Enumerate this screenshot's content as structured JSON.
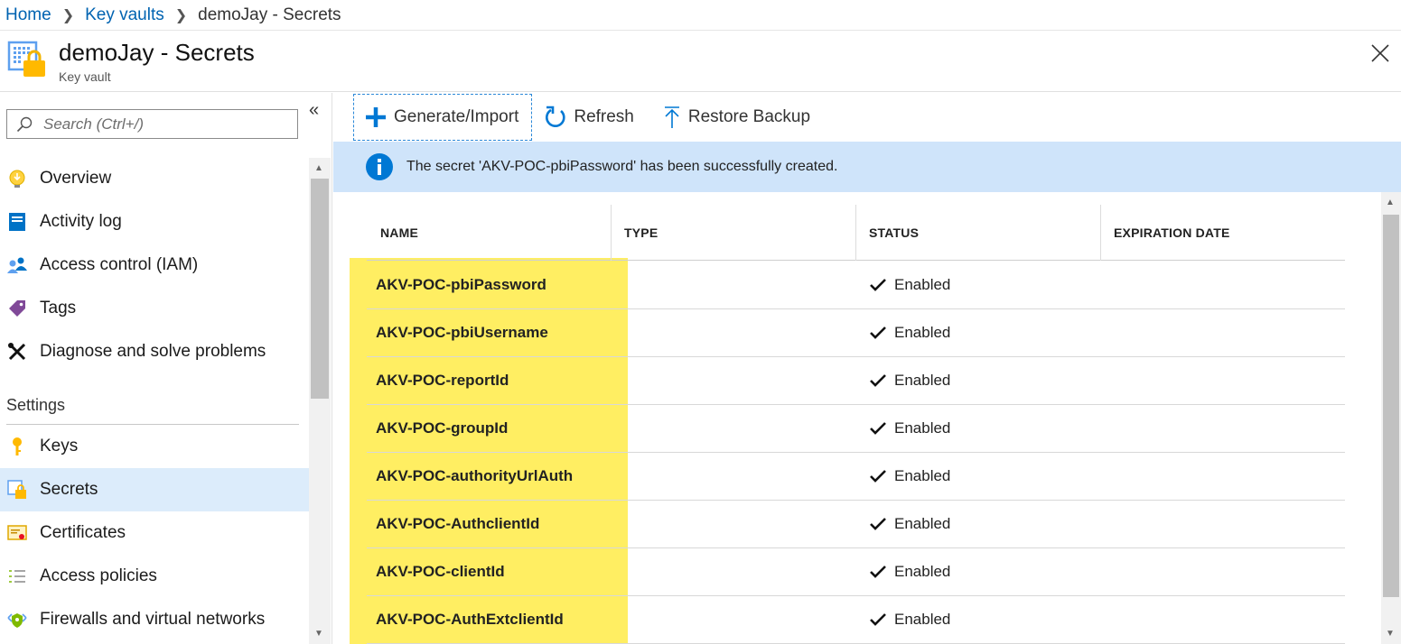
{
  "breadcrumb": {
    "home": "Home",
    "keyvaults": "Key vaults",
    "current": "demoJay - Secrets"
  },
  "header": {
    "title": "demoJay - Secrets",
    "subtitle": "Key vault"
  },
  "sidebar": {
    "search_placeholder": "Search (Ctrl+/)",
    "collapse_glyph": "«",
    "items": [
      {
        "label": "Overview",
        "icon": "lightbulb-icon"
      },
      {
        "label": "Activity log",
        "icon": "activity-log-icon"
      },
      {
        "label": "Access control (IAM)",
        "icon": "people-icon"
      },
      {
        "label": "Tags",
        "icon": "tag-icon"
      },
      {
        "label": "Diagnose and solve problems",
        "icon": "wrench-icon"
      }
    ],
    "section_settings": "Settings",
    "settings_items": [
      {
        "label": "Keys",
        "icon": "key-icon"
      },
      {
        "label": "Secrets",
        "icon": "secret-icon",
        "selected": true
      },
      {
        "label": "Certificates",
        "icon": "certificate-icon"
      },
      {
        "label": "Access policies",
        "icon": "list-icon"
      },
      {
        "label": "Firewalls and virtual networks",
        "icon": "network-icon"
      }
    ]
  },
  "toolbar": {
    "generate_label": "Generate/Import",
    "refresh_label": "Refresh",
    "restore_label": "Restore Backup"
  },
  "notification": {
    "message": "The secret 'AKV-POC-pbiPassword' has been successfully created."
  },
  "table": {
    "columns": [
      "NAME",
      "TYPE",
      "STATUS",
      "EXPIRATION DATE"
    ],
    "rows": [
      {
        "name": "AKV-POC-pbiPassword",
        "type": "",
        "status": "Enabled",
        "expiration": ""
      },
      {
        "name": "AKV-POC-pbiUsername",
        "type": "",
        "status": "Enabled",
        "expiration": ""
      },
      {
        "name": "AKV-POC-reportId",
        "type": "",
        "status": "Enabled",
        "expiration": ""
      },
      {
        "name": "AKV-POC-groupId",
        "type": "",
        "status": "Enabled",
        "expiration": ""
      },
      {
        "name": "AKV-POC-authorityUrlAuth",
        "type": "",
        "status": "Enabled",
        "expiration": ""
      },
      {
        "name": "AKV-POC-AuthclientId",
        "type": "",
        "status": "Enabled",
        "expiration": ""
      },
      {
        "name": "AKV-POC-clientId",
        "type": "",
        "status": "Enabled",
        "expiration": ""
      },
      {
        "name": "AKV-POC-AuthExtclientId",
        "type": "",
        "status": "Enabled",
        "expiration": ""
      }
    ]
  },
  "colors": {
    "link": "#0063b1",
    "accent": "#0078d4",
    "selected_bg": "#dcecfb",
    "notification_bg": "#cfe4fa",
    "highlight": "#ffee62"
  }
}
